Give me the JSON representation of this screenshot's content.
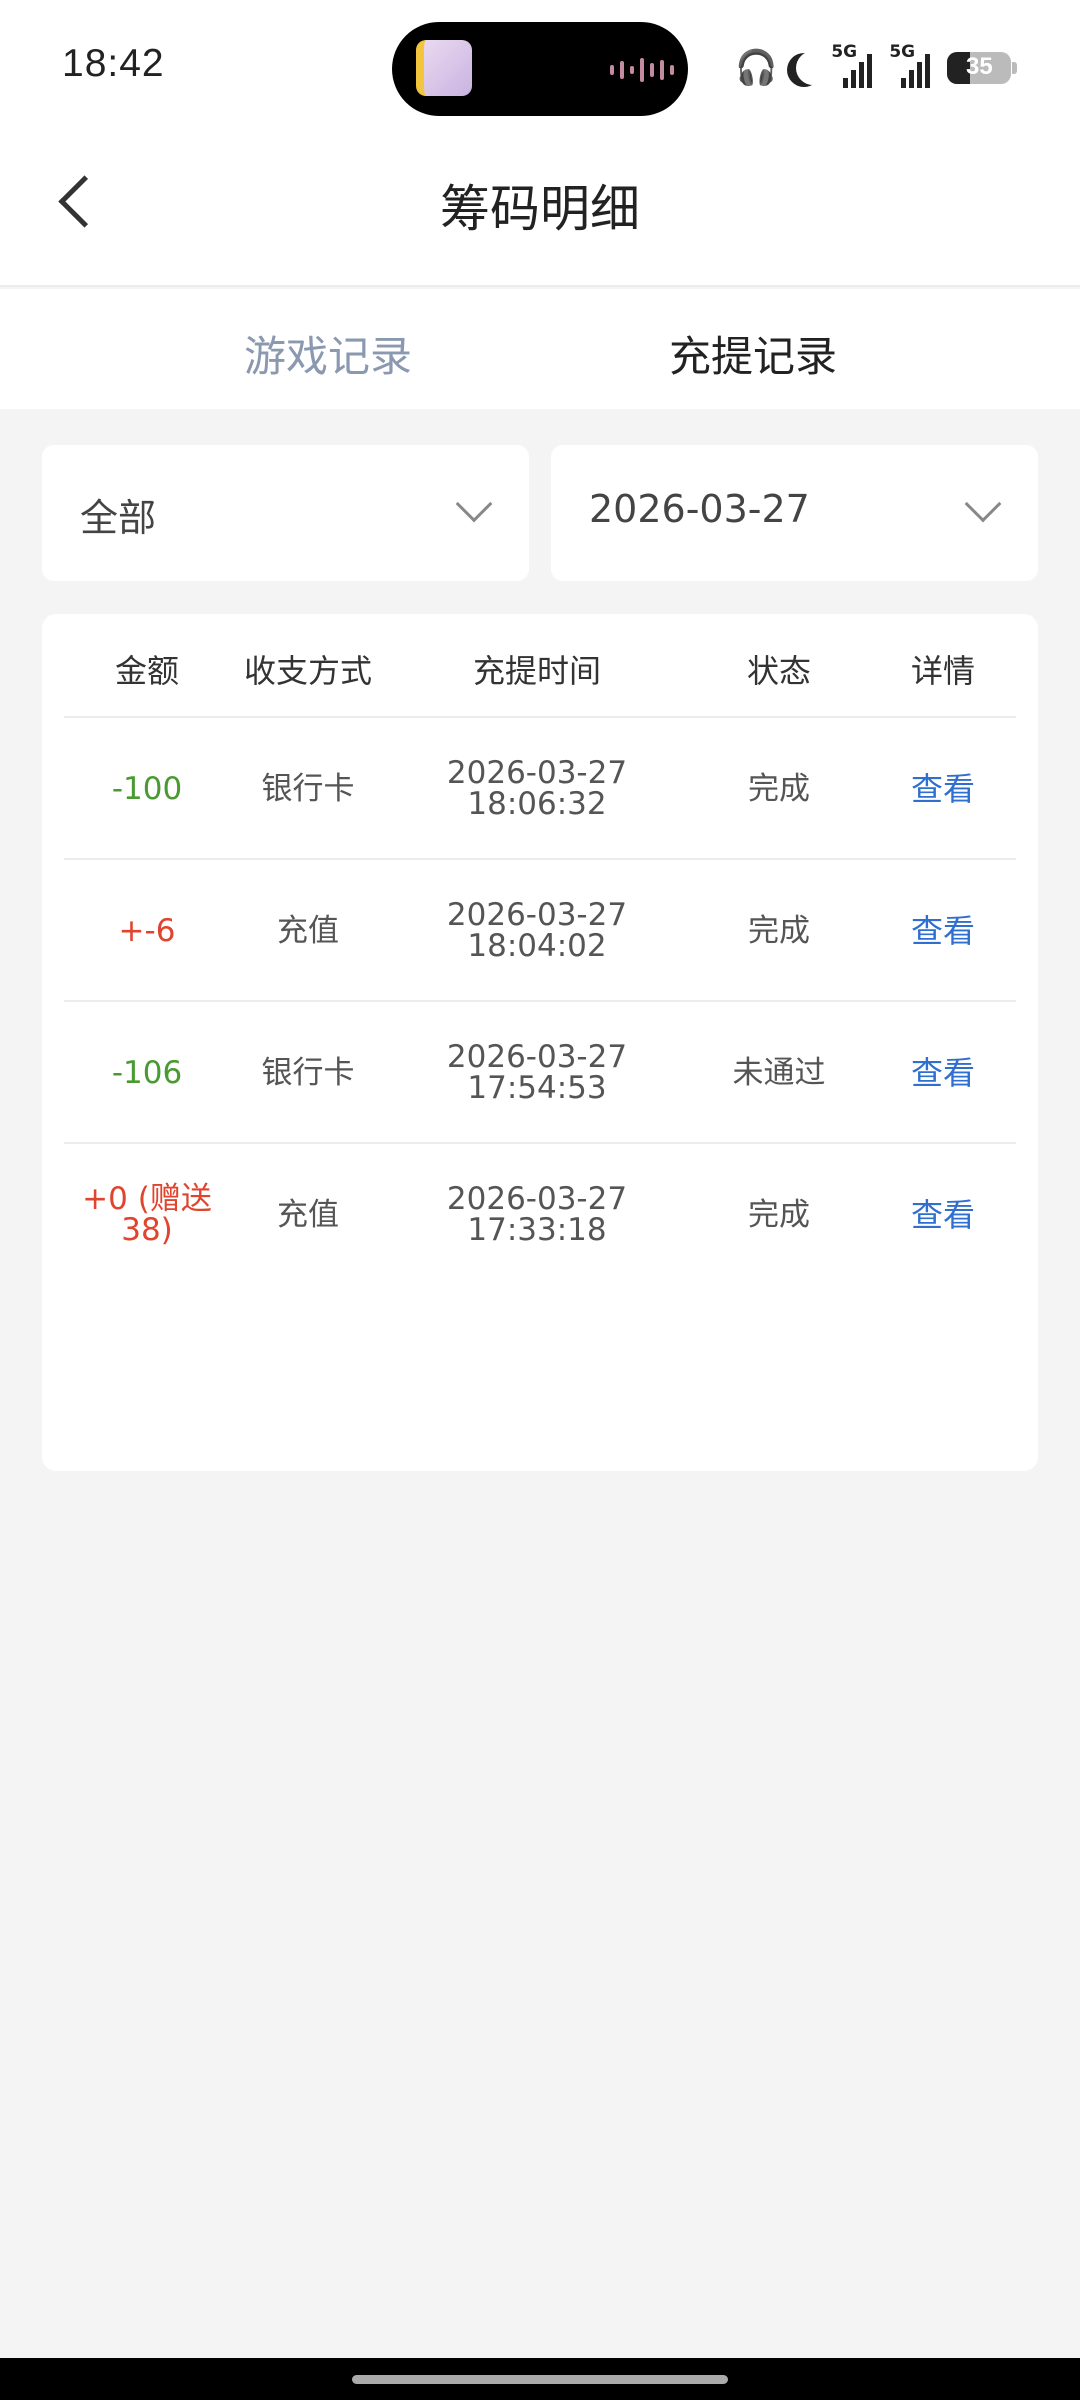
{
  "status": {
    "time": "18:42",
    "battery": "35"
  },
  "header": {
    "title": "筹码明细"
  },
  "tabs": [
    {
      "label": "游戏记录"
    },
    {
      "label": "充提记录"
    }
  ],
  "filters": {
    "type": "全部",
    "date": "2026-03-27"
  },
  "table": {
    "headers": [
      "金额",
      "收支方式",
      "充提时间",
      "状态",
      "详情"
    ],
    "rows": [
      {
        "amount": "-100",
        "method": "银行卡",
        "date": "2026-03-27",
        "time": "18:06:32",
        "status": "完成",
        "action": "查看"
      },
      {
        "amount": "+-6",
        "method": "充值",
        "date": "2026-03-27",
        "time": "18:04:02",
        "status": "完成",
        "action": "查看"
      },
      {
        "amount": "-106",
        "method": "银行卡",
        "date": "2026-03-27",
        "time": "17:54:53",
        "status": "未通过",
        "action": "查看"
      },
      {
        "amount": "+0 (赠送38)",
        "method": "充值",
        "date": "2026-03-27",
        "time": "17:33:18",
        "status": "完成",
        "action": "查看"
      }
    ]
  },
  "colors": {
    "negative": "#4a9a32",
    "positive": "#e0442e",
    "link": "#2f6fd0",
    "tab_inactive": "#8a98b0"
  }
}
